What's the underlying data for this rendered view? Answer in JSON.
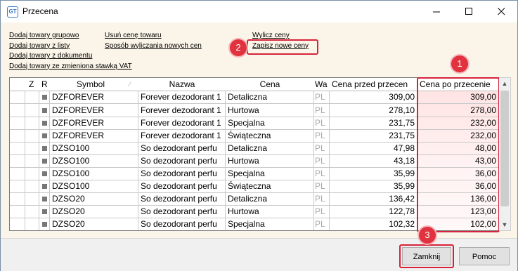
{
  "window": {
    "title": "Przecena",
    "icon": "gt-app-icon"
  },
  "links": {
    "col1": [
      "Dodaj towary grupowo",
      "Dodaj towary z listy",
      "Dodaj towary z dokumentu",
      "Dodaj towary ze zmieniona stawką VAT"
    ],
    "col2": [
      "Usuń cenę towaru",
      "Sposób wyliczania nowych cen"
    ],
    "col3": [
      "Wylicz ceny",
      "Zapisz nowe ceny"
    ]
  },
  "grid": {
    "headers": [
      "Z",
      "R",
      "Symbol",
      "Nazwa",
      "Cena",
      "Wa",
      "Cena przed przecen",
      "Cena po przecenie"
    ],
    "rows": [
      [
        "DZFOREVER",
        "Forever dezodorant 1",
        "Detaliczna",
        "PL",
        "309,00",
        "309,00"
      ],
      [
        "DZFOREVER",
        "Forever dezodorant 1",
        "Hurtowa",
        "PL",
        "278,10",
        "278,00"
      ],
      [
        "DZFOREVER",
        "Forever dezodorant 1",
        "Specjalna",
        "PL",
        "231,75",
        "232,00"
      ],
      [
        "DZFOREVER",
        "Forever dezodorant 1",
        "Świąteczna",
        "PL",
        "231,75",
        "232,00"
      ],
      [
        "DZSO100",
        "So dezodorant perfu",
        "Detaliczna",
        "PL",
        "47,98",
        "48,00"
      ],
      [
        "DZSO100",
        "So dezodorant perfu",
        "Hurtowa",
        "PL",
        "43,18",
        "43,00"
      ],
      [
        "DZSO100",
        "So dezodorant perfu",
        "Specjalna",
        "PL",
        "35,99",
        "36,00"
      ],
      [
        "DZSO100",
        "So dezodorant perfu",
        "Świąteczna",
        "PL",
        "35,99",
        "36,00"
      ],
      [
        "DZSO20",
        "So dezodorant perfu",
        "Detaliczna",
        "PL",
        "136,42",
        "136,00"
      ],
      [
        "DZSO20",
        "So dezodorant perfu",
        "Hurtowa",
        "PL",
        "122,78",
        "123,00"
      ],
      [
        "DZSO20",
        "So dezodorant perfu",
        "Specjalna",
        "PL",
        "102,32",
        "102,00"
      ]
    ]
  },
  "badges": [
    "1",
    "2",
    "3"
  ],
  "buttons": {
    "close": "Zamknij",
    "help": "Pomoc"
  },
  "colors": {
    "highlight": "#d6233b",
    "badge": "#e1323f",
    "content_bg": "#fbf5e9"
  }
}
